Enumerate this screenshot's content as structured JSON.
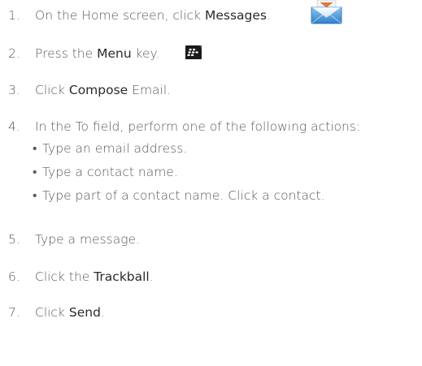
{
  "steps": [
    {
      "num": "1.",
      "pre": "On the Home screen, click ",
      "kw": "Messages",
      "post": "."
    },
    {
      "num": "2.",
      "pre": "Press the ",
      "kw": "Menu",
      "post": " key."
    },
    {
      "num": "3.",
      "pre": "Click ",
      "kw": "Compose",
      "post": " Email."
    },
    {
      "num": "4.",
      "text": "In the To field, perform one of the following actions:"
    },
    {
      "num": "5.",
      "text": "Type a message."
    },
    {
      "num": "6.",
      "pre": "Click the ",
      "kw": "Trackball",
      "post": "."
    },
    {
      "num": "7.",
      "pre": "Click ",
      "kw": "Send",
      "post": "."
    }
  ],
  "sub_items": [
    {
      "bullet": "•",
      "text": "Type an email address."
    },
    {
      "bullet": "•",
      "text": "Type a contact name."
    },
    {
      "bullet": "•",
      "text": "Type part of a contact name. Click a contact."
    }
  ],
  "icons": {
    "messages": "envelope-icon",
    "menu": "blackberry-menu-key-icon"
  },
  "colors": {
    "text": "#5a5a5a",
    "keyword": "#2a2a2a",
    "menu_key_bg": "#1a1a1a",
    "envelope_blue": "#3a8fd6"
  }
}
